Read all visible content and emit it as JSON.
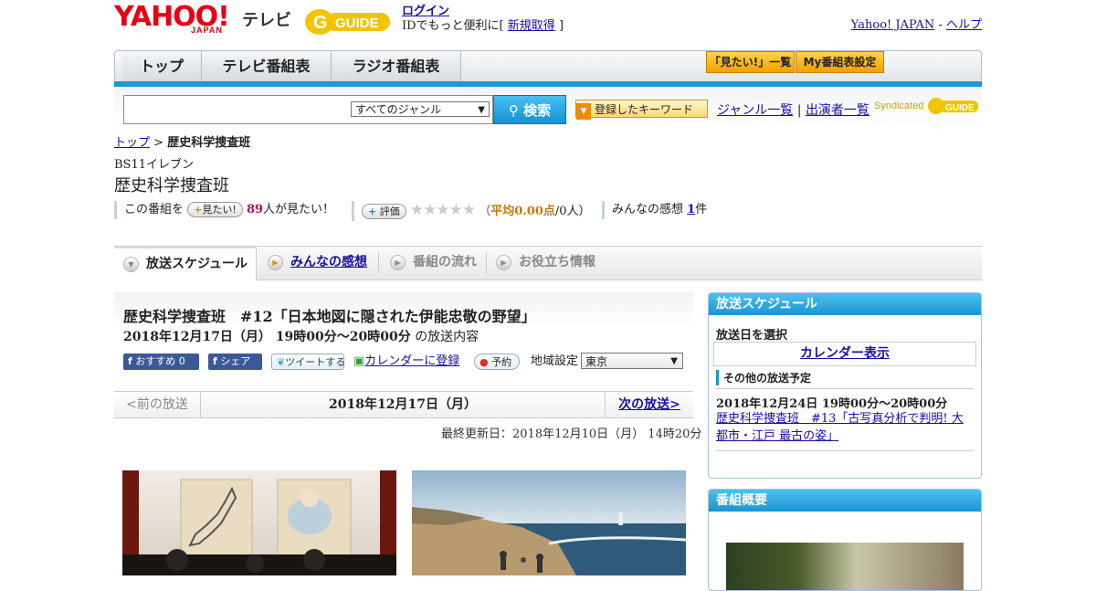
{
  "header": {
    "yahoo_logo": "YAHOO!",
    "yahoo_japan": "JAPAN",
    "tv_label": "テレビ",
    "gguide_logo": "GUIDE",
    "login_link": "ログイン",
    "login_text": "IDでもっと便利に[",
    "register_link": "新規取得",
    "login_text_end": "]",
    "yahoo_japan_link": "Yahoo! JAPAN",
    "dash": "-",
    "help_link": "ヘルプ"
  },
  "nav": {
    "tabs": [
      "トップ",
      "テレビ番組表",
      "ラジオ番組表"
    ],
    "watchlist_button": "「見たい!」一覧",
    "my_schedule_button": "My番組表設定"
  },
  "search": {
    "input_value": "",
    "genre_selected": "すべてのジャンル",
    "search_button": "検索",
    "keyword_button": "登録したキーワード",
    "genre_list_link": "ジャンル一覧",
    "separator": "|",
    "cast_list_link": "出演者一覧",
    "syndicated": "Syndicated",
    "syndicated_logo": "GUIDE"
  },
  "breadcrumb": {
    "top": "トップ",
    "sep": ">",
    "current": "歴史科学捜査班"
  },
  "program": {
    "channel": "BS11イレブン",
    "title": "歴史科学捜査班",
    "want_prefix": "この番組を",
    "want_button": "見たい!",
    "want_count": "89",
    "want_suffix": "人が見たい！",
    "rate_button": "評価",
    "stars": "★★★★★",
    "rating_open": "（",
    "rating_label": "平均0.00点",
    "rating_suffix": "/0人）",
    "reviews_prefix": "みんなの感想",
    "reviews_count": "1",
    "reviews_suffix": "件"
  },
  "tabs": [
    {
      "label": "放送スケジュール"
    },
    {
      "label": "みんなの感想"
    },
    {
      "label": "番組の流れ"
    },
    {
      "label": "お役立ち情報"
    }
  ],
  "episode": {
    "title": "歴史科学捜査班　#12「日本地図に隠された伊能忠敬の野望」",
    "date": "2018年12月17日（月）  19時00分～20時00分",
    "date_suffix": "の放送内容",
    "fb_recommend": "おすすめ",
    "fb_count": "0",
    "fb_share": "シェア",
    "tweet": "ツイートする",
    "calendar": "カレンダーに登録",
    "reserve": "予約",
    "region_label": "地域設定",
    "region_value": "東京",
    "prev": "<前の放送",
    "current_date": "2018年12月17日（月）",
    "next": "次の放送>",
    "updated": "最終更新日：2018年12月10日（月）  14時20分"
  },
  "sidebar": {
    "schedule_head": "放送スケジュール",
    "select_label": "放送日を選択",
    "calendar_button": "カレンダー表示",
    "other_head": "その他の放送予定",
    "other_date": "2018年12月24日  19時00分～20時00分",
    "other_link": "歴史科学捜査班　#13「古写真分析で判明! 大都市・江戸 最古の姿」",
    "overview_head": "番組概要"
  },
  "colors": {
    "accent_blue": "#1a94d2",
    "yahoo_red": "#e60012",
    "gold": "#f0a000"
  }
}
